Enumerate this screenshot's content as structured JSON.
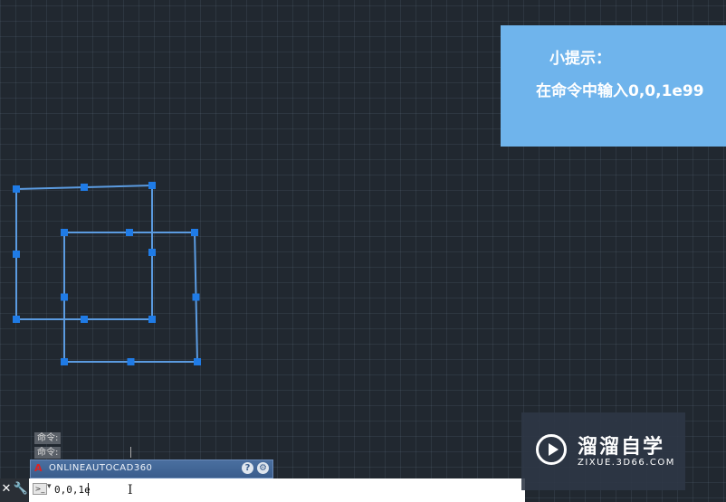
{
  "tip": {
    "title": "小提示：",
    "text": "在命令中输入0,0,1e99"
  },
  "command_history": [
    "命令:",
    "命令:"
  ],
  "titlebar": {
    "logo": "A",
    "title": "ONLINEAUTOCAD360",
    "help_label": "?",
    "settings_label": "⚙"
  },
  "command_line": {
    "close_label": "✕",
    "tools_label": "🔧",
    "prompt_icon_label": ">_",
    "prompt_arrow": "▾",
    "input_value": "0,0,1e"
  },
  "watermark": {
    "name": "溜溜自学",
    "domain": "ZIXUE.3D66.COM"
  },
  "colors": {
    "canvas_bg": "#212830",
    "selection": "#5b9be0",
    "grip": "#1f7be6",
    "tip_bg": "#6fb4ec"
  }
}
